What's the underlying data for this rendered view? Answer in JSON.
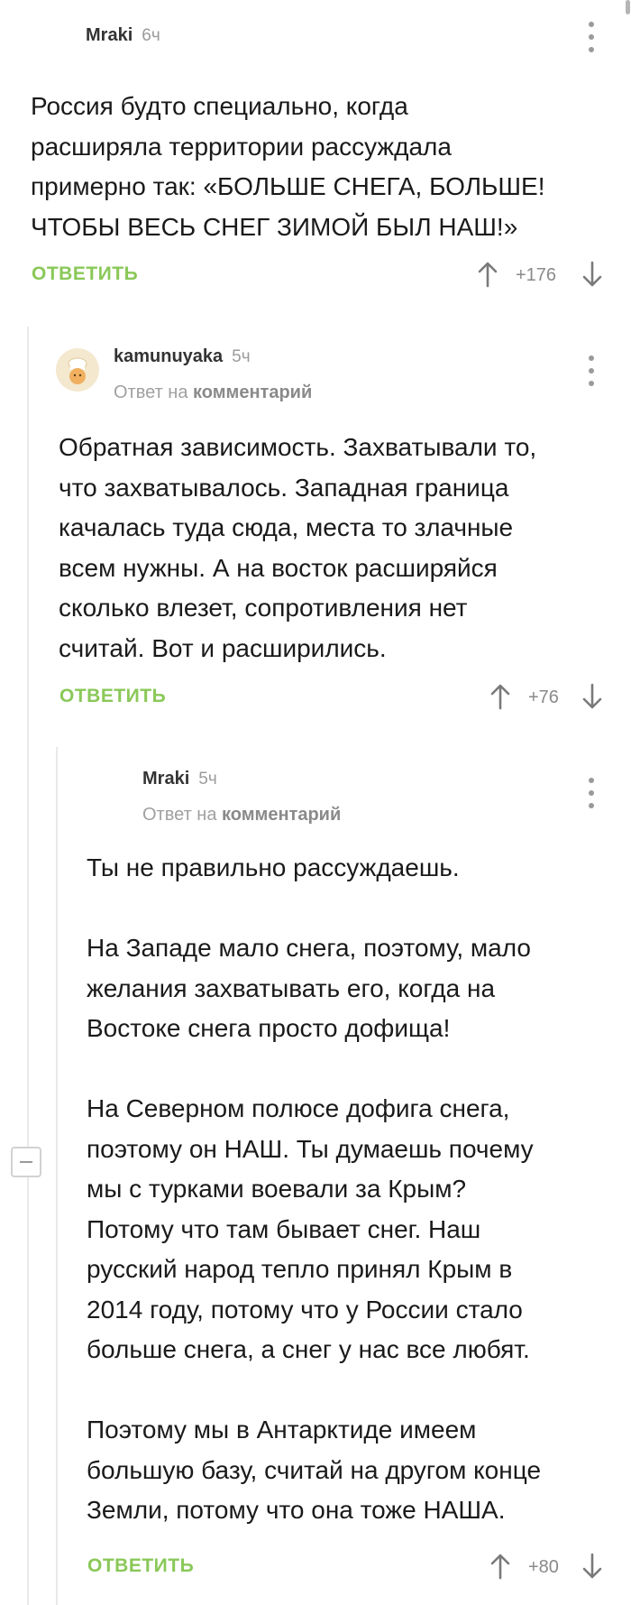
{
  "comments": [
    {
      "author": "Mraki",
      "time": "6ч",
      "text": "Россия будто специально, когда\nрасширяла территории рассуждала\nпримерно так: «БОЛЬШЕ СНЕГА, БОЛЬШЕ!\nЧТОБЫ ВЕСЬ СНЕГ ЗИМОЙ БЫЛ НАШ!»",
      "reply_label": "ОТВЕТИТЬ",
      "score": "+176"
    },
    {
      "author": "kamunuyaka",
      "time": "5ч",
      "reply_prefix": "Ответ на",
      "reply_target": "комментарий",
      "text": "Обратная зависимость. Захватывали то,\nчто захватывалось. Западная граница\nкачалась туда сюда, места то злачные\nвсем нужны. А на восток расширяйся\nсколько влезет, сопротивления нет\nсчитай. Вот и расширились.",
      "reply_label": "ОТВЕТИТЬ",
      "score": "+76"
    },
    {
      "author": "Mraki",
      "time": "5ч",
      "reply_prefix": "Ответ на",
      "reply_target": "комментарий",
      "text": "Ты не правильно рассуждаешь.\n\nНа Западе мало снега, поэтому, мало\nжелания захватывать его, когда на\nВостоке снега просто дофища!\n\nНа Северном полюсе дофига снега,\nпоэтому он НАШ. Ты думаешь почему\nмы с турками воевали за Крым?\nПотому что там бывает снег. Наш\nрусский народ тепло принял Крым в\n2014 году, потому что у России стало\nбольше снега, а снег у нас все любят.\n\nПоэтому мы в Антарктиде имеем\nбольшую базу, считай на другом конце\nЗемли, потому что она тоже НАША.",
      "reply_label": "ОТВЕТИТЬ",
      "score": "+80"
    }
  ],
  "colors": {
    "reply": "#8ac858",
    "muted": "#9b9b9b",
    "thread_line": "#e9e9e9"
  },
  "icons": {
    "upvote": "arrow-up-icon",
    "downvote": "arrow-down-icon",
    "menu": "more-vertical-icon",
    "collapse": "minus-box-icon",
    "avatar": "chef-avatar"
  }
}
